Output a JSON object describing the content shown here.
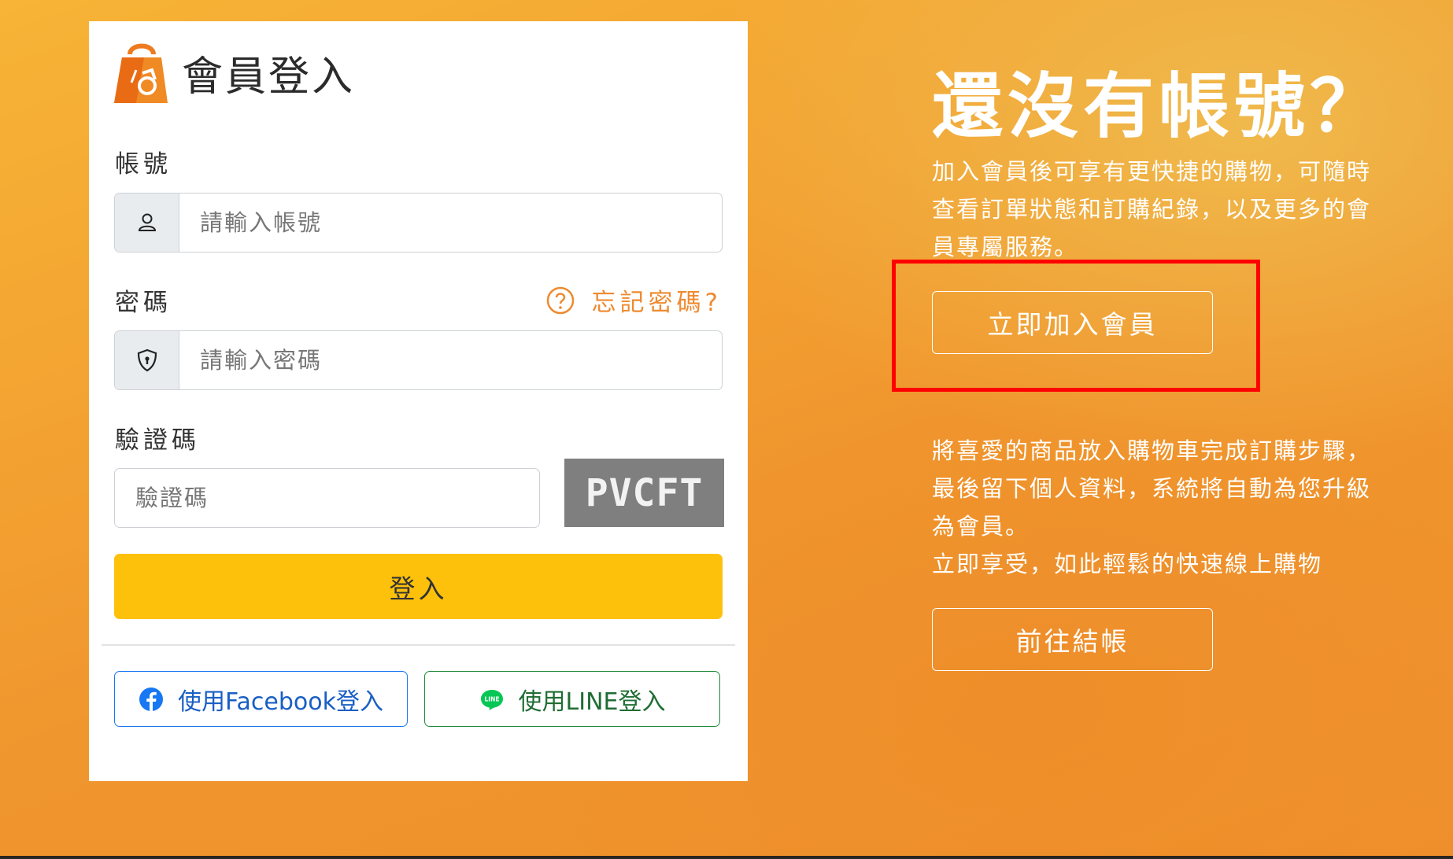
{
  "login": {
    "title": "會員登入",
    "account_label": "帳號",
    "account_placeholder": "請輸入帳號",
    "password_label": "密碼",
    "forgot_password": "忘記密碼?",
    "password_placeholder": "請輸入密碼",
    "captcha_label": "驗證碼",
    "captcha_placeholder": "驗證碼",
    "captcha_code": "PVCFT",
    "submit": "登入",
    "facebook_login": "使用Facebook登入",
    "line_login": "使用LINE登入"
  },
  "promo": {
    "title": "還沒有帳號？",
    "description_1": "加入會員後可享有更快捷的購物，可隨時查看訂單狀態和訂購紀錄，以及更多的會員專屬服務。",
    "join_button": "立即加入會員",
    "description_2": "將喜愛的商品放入購物車完成訂購步驟，最後留下個人資料，系統將自動為您升級為會員。",
    "description_3": "立即享受，如此輕鬆的快速線上購物",
    "checkout_button": "前往結帳"
  },
  "colors": {
    "accent_orange": "#ee8a30",
    "login_button": "#fec10b",
    "facebook_blue": "#1877f2",
    "line_green": "#06c755",
    "highlight": "#ff0000"
  },
  "icons": {
    "brand": "shopping-bag-logo",
    "account": "user-icon",
    "password": "shield-keyhole-icon",
    "forgot": "question-circle-icon",
    "facebook": "facebook-icon",
    "line": "line-icon"
  }
}
